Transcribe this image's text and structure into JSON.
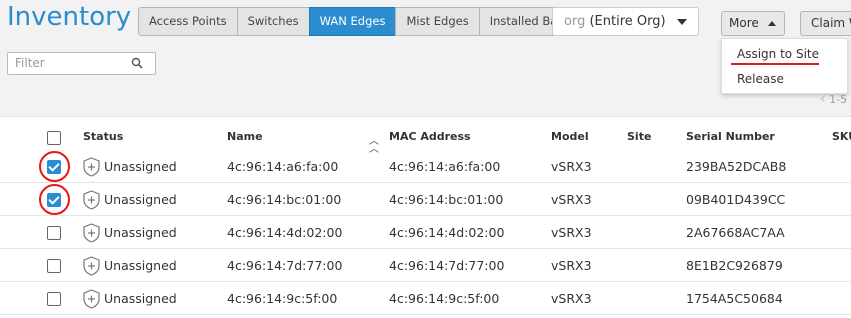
{
  "page": {
    "title": "Inventory"
  },
  "tabs": [
    {
      "label": "Access Points",
      "active": false
    },
    {
      "label": "Switches",
      "active": false
    },
    {
      "label": "WAN Edges",
      "active": true
    },
    {
      "label": "Mist Edges",
      "active": false
    },
    {
      "label": "Installed Base",
      "active": false
    }
  ],
  "org_select": {
    "prefix": "org",
    "value": "(Entire Org)"
  },
  "toolbar": {
    "more_label": "More",
    "claim_label": "Claim W"
  },
  "more_menu": {
    "items": [
      "Assign to Site",
      "Release"
    ]
  },
  "filter": {
    "placeholder": "Filter"
  },
  "pager": {
    "text": "1-5"
  },
  "table": {
    "columns": [
      "Status",
      "Name",
      "MAC Address",
      "Model",
      "Site",
      "Serial Number",
      "SKU"
    ],
    "rows": [
      {
        "checked": true,
        "status": "Unassigned",
        "name": "4c:96:14:a6:fa:00",
        "mac": "4c:96:14:a6:fa:00",
        "model": "vSRX3",
        "site": "",
        "serial": "239BA52DCAB8"
      },
      {
        "checked": true,
        "status": "Unassigned",
        "name": "4c:96:14:bc:01:00",
        "mac": "4c:96:14:bc:01:00",
        "model": "vSRX3",
        "site": "",
        "serial": "09B401D439CC"
      },
      {
        "checked": false,
        "status": "Unassigned",
        "name": "4c:96:14:4d:02:00",
        "mac": "4c:96:14:4d:02:00",
        "model": "vSRX3",
        "site": "",
        "serial": "2A67668AC7AA"
      },
      {
        "checked": false,
        "status": "Unassigned",
        "name": "4c:96:14:7d:77:00",
        "mac": "4c:96:14:7d:77:00",
        "model": "vSRX3",
        "site": "",
        "serial": "8E1B2C926879"
      },
      {
        "checked": false,
        "status": "Unassigned",
        "name": "4c:96:14:9c:5f:00",
        "mac": "4c:96:14:9c:5f:00",
        "model": "vSRX3",
        "site": "",
        "serial": "1754A5C50684"
      }
    ]
  },
  "colors": {
    "accent": "#2b8ccf",
    "highlight": "#e31a1a"
  }
}
